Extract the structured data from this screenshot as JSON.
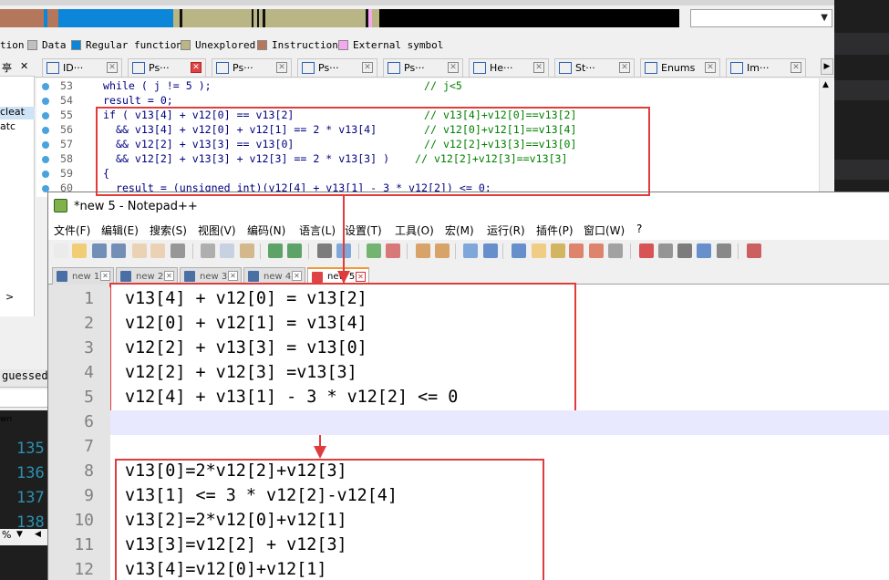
{
  "ida": {
    "legend": [
      {
        "label": "tion",
        "color": "#f0f0f0"
      },
      {
        "label": "Data",
        "color": "#c0c0c0"
      },
      {
        "label": "Regular function",
        "color": "#0b86d8"
      },
      {
        "label": "Unexplored",
        "color": "#b9b585"
      },
      {
        "label": "Instruction",
        "color": "#b5775c"
      },
      {
        "label": "External symbol",
        "color": "#f7a7f0"
      }
    ],
    "tabs": [
      {
        "icon": "ID",
        "label": "ID···"
      },
      {
        "icon": "Ps",
        "label": "Ps···"
      },
      {
        "icon": "Ps",
        "label": "Ps···"
      },
      {
        "icon": "Ps",
        "label": "Ps···"
      },
      {
        "icon": "Ps",
        "label": "Ps···"
      },
      {
        "icon": "He",
        "label": "He···"
      },
      {
        "icon": "St",
        "label": "St···"
      },
      {
        "icon": "En",
        "label": "Enums"
      },
      {
        "icon": "Im",
        "label": "Im···"
      }
    ],
    "left_panel": [
      "cleat",
      "atc",
      ">"
    ],
    "code_lines": [
      {
        "n": "53",
        "code": "while ( j != 5 );",
        "comment": "// j<5"
      },
      {
        "n": "54",
        "code": "result = 0;",
        "comment": ""
      },
      {
        "n": "55",
        "code": "if ( v13[4] + v12[0] == v13[2]",
        "comment": "// v13[4]+v12[0]==v13[2]"
      },
      {
        "n": "56",
        "code": "  && v13[4] + v12[0] + v12[1] == 2 * v13[4]",
        "comment": "// v12[0]+v12[1]==v13[4]"
      },
      {
        "n": "57",
        "code": "  && v12[2] + v13[3] == v13[0]",
        "comment": "// v12[2]+v13[3]==v13[0]"
      },
      {
        "n": "58",
        "code": "  && v12[2] + v13[3] + v12[3] == 2 * v13[3] )",
        "comment": "// v12[2]+v12[3]==v13[3]"
      },
      {
        "n": "59",
        "code": "{",
        "comment": ""
      },
      {
        "n": "60",
        "code": "  result = (unsigned int)(v12[4] + v13[1] - 3 * v12[2]) <= 0;",
        "comment": ""
      }
    ],
    "guessed_label": "guessed",
    "wn_label": "wn",
    "dark_numbers": [
      "135",
      "136",
      "137",
      "138"
    ],
    "pct_label": "%"
  },
  "notepad": {
    "title": "*new 5 - Notepad++",
    "menu": [
      "文件(F)",
      "编辑(E)",
      "搜索(S)",
      "视图(V)",
      "编码(N)",
      "语言(L)",
      "设置(T)",
      "工具(O)",
      "宏(M)",
      "运行(R)",
      "插件(P)",
      "窗口(W)",
      "?"
    ],
    "tabs": [
      "new 1",
      "new 2",
      "new 3",
      "new 4",
      "new 5"
    ],
    "active_tab": 4,
    "lines": [
      {
        "n": "1",
        "text": "v13[4] + v12[0] = v13[2]"
      },
      {
        "n": "2",
        "text": "v12[0] + v12[1] = v13[4]"
      },
      {
        "n": "3",
        "text": "v12[2] + v13[3] = v13[0]"
      },
      {
        "n": "4",
        "text": "v12[2] + v12[3] =v13[3]"
      },
      {
        "n": "5",
        "text": "v12[4] + v13[1] - 3 * v12[2] <= 0"
      },
      {
        "n": "6",
        "text": ""
      },
      {
        "n": "7",
        "text": ""
      },
      {
        "n": "8",
        "text": "v13[0]=2*v12[2]+v12[3]"
      },
      {
        "n": "9",
        "text": "v13[1] <= 3 * v12[2]-v12[4]"
      },
      {
        "n": "10",
        "text": "v13[2]=2*v12[0]+v12[1]"
      },
      {
        "n": "11",
        "text": "v13[3]=v12[2] + v12[3]"
      },
      {
        "n": "12",
        "text": "v13[4]=v12[0]+v12[1]"
      }
    ],
    "current_line": 6
  },
  "colors": {
    "annotation_red": "#e03c3c",
    "ida_blue_func": "#0b86d8",
    "ida_olive": "#b9b585"
  }
}
